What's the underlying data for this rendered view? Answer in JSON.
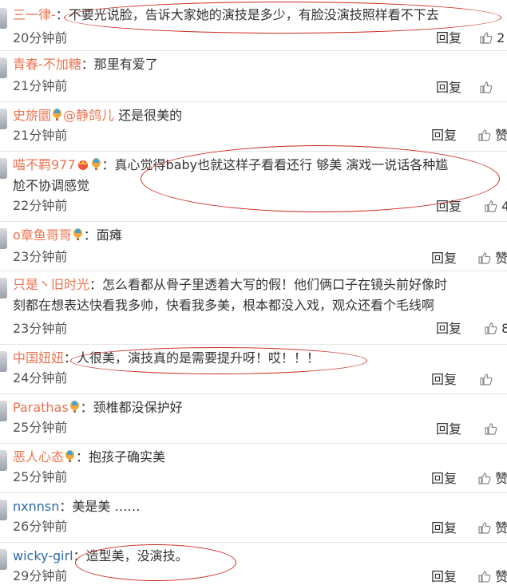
{
  "comments": [
    {
      "user": "三一律-",
      "text": "：不要光说脸，告诉大家她的演技是多少，有脸没演技照样看不下去",
      "time": "20分钟前",
      "reply": "回复",
      "like": "2"
    },
    {
      "user": "青春-不加糖",
      "text": "：那里有爱了",
      "time": "21分钟前",
      "reply": "回复",
      "like": ""
    },
    {
      "user": "史旂圜",
      "mention": "@静鸽儿",
      "text": " 还是很美的",
      "time": "21分钟前",
      "reply": "回复",
      "like": "赞"
    },
    {
      "user": "喵不羁977",
      "text": "：真心觉得baby也就这样子看看还行 够美 演戏一说话各种尴",
      "text2": "尬不协调感觉",
      "time": "22分钟前",
      "reply": "回复",
      "like": "4"
    },
    {
      "user": "o章鱼哥哥",
      "text": "：面瘫",
      "time": "23分钟前",
      "reply": "回复",
      "like": "赞"
    },
    {
      "user": "只是丶旧时光",
      "text": "：怎么看都从骨子里透着大写的假！他们俩口子在镜头前好像时",
      "text2": "刻都在想表达快看我多帅，快看我多美，根本都没入戏，观众还看个毛线啊",
      "time": "23分钟前",
      "reply": "回复",
      "like": "8"
    },
    {
      "user": "中国妞妞",
      "text": "：人很美，演技真的是需要提升呀！哎！！！",
      "time": "24分钟前",
      "reply": "回复",
      "like": ""
    },
    {
      "user": "Parathas",
      "text": "：颈椎都没保护好",
      "time": "25分钟前",
      "reply": "回复",
      "like": ""
    },
    {
      "user": "恶人心态",
      "text": "：抱孩子确实美",
      "time": "25分钟前",
      "reply": "回复",
      "like": "赞"
    },
    {
      "user": "nxnnsn",
      "text": "：美是美 ……",
      "time": "26分钟前",
      "reply": "回复",
      "like": "赞"
    },
    {
      "user": "wicky-girl",
      "text": "：造型美，没演技。",
      "time": "29分钟前",
      "reply": "回复",
      "like": "赞"
    }
  ]
}
